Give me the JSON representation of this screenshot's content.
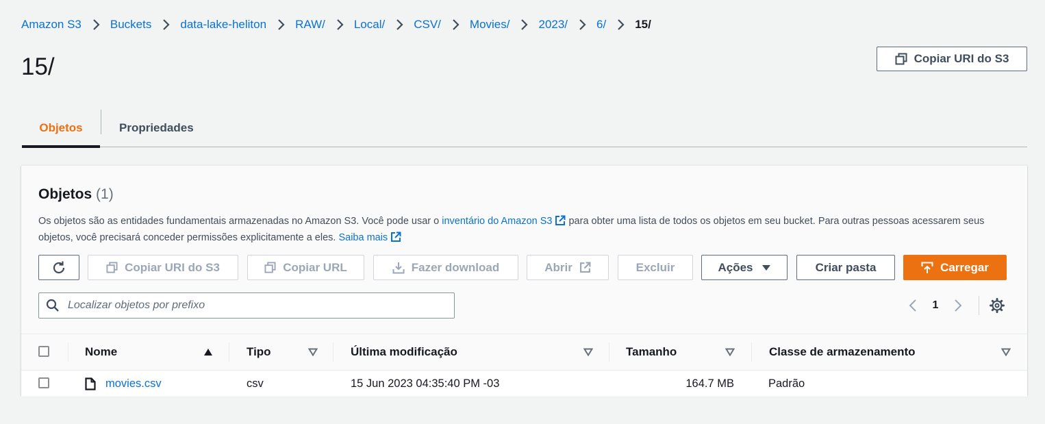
{
  "breadcrumb": [
    "Amazon S3",
    "Buckets",
    "data-lake-heliton",
    "RAW/",
    "Local/",
    "CSV/",
    "Movies/",
    "2023/",
    "6/",
    "15/"
  ],
  "page_title": "15/",
  "header_actions": {
    "copy_uri": "Copiar URI do S3"
  },
  "tabs": [
    {
      "label": "Objetos",
      "active": true
    },
    {
      "label": "Propriedades",
      "active": false
    }
  ],
  "objects_panel": {
    "title": "Objetos",
    "count": "(1)",
    "description": {
      "part1": "Os objetos são as entidades fundamentais armazenadas no Amazon S3. Você pode usar o ",
      "link1": "inventário do Amazon S3",
      "part2": " para obter uma lista de todos os objetos em seu bucket. Para outras pessoas acessarem seus objetos, você precisará conceder permissões explicitamente a eles. ",
      "link2": "Saiba mais"
    },
    "toolbar": {
      "copy_uri": "Copiar URI do S3",
      "copy_url": "Copiar URL",
      "download": "Fazer download",
      "open": "Abrir",
      "delete": "Excluir",
      "actions": "Ações",
      "create_folder": "Criar pasta",
      "upload": "Carregar"
    },
    "search": {
      "placeholder": "Localizar objetos por prefixo",
      "value": ""
    },
    "pagination": {
      "current_page": "1"
    },
    "table": {
      "columns": [
        "Nome",
        "Tipo",
        "Última modificação",
        "Tamanho",
        "Classe de armazenamento"
      ],
      "rows": [
        {
          "name": "movies.csv",
          "type": "csv",
          "modified": "15 Jun 2023 04:35:40 PM -03",
          "size": "164.7 MB",
          "storage_class": "Padrão"
        }
      ]
    }
  },
  "colors": {
    "link": "#0972d3",
    "accent": "#ec7211",
    "text": "#16191f",
    "background": "#f2f3f3"
  }
}
